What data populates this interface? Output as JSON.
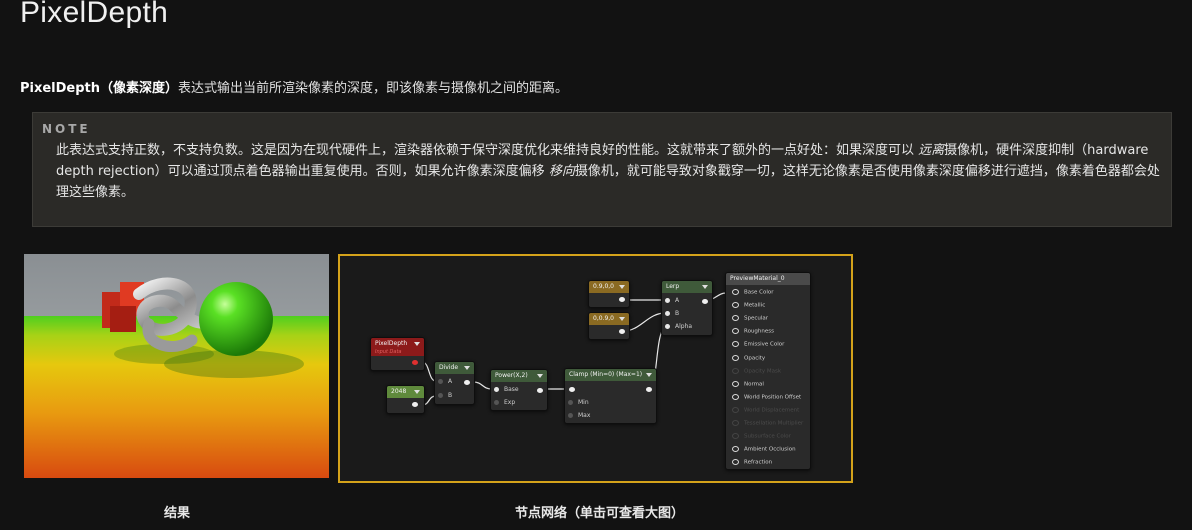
{
  "page": {
    "title": "PixelDepth",
    "intro_bold": "PixelDepth（像素深度）",
    "intro_rest": "表达式输出当前所渲染像素的深度，即该像素与摄像机之间的距离。"
  },
  "note": {
    "label": "NOTE",
    "text_1": "此表达式支持正数，不支持负数。这是因为在现代硬件上，渲染器依赖于保守深度优化来维持良好的性能。这就带来了额外的一点好处：如果深度可以 ",
    "em_1": "远离",
    "text_2": "摄像机，硬件深度抑制（hardware depth rejection）可以通过顶点着色器输出重复使用。否则，如果允许像素深度偏移 ",
    "em_2": "移向",
    "text_3": "摄像机，就可能导致对象戳穿一切，这样无论像素是否使用像素深度偏移进行遮挡，像素着色器都会处理这些像素。"
  },
  "captions": {
    "result": "结果",
    "graph": "节点网络（单击可查看大图）"
  },
  "graph": {
    "pixel_depth": {
      "title": "PixelDepth",
      "subtitle": "Input Data"
    },
    "constant_2048": {
      "value": "2048"
    },
    "divide": {
      "title": "Divide",
      "pin_a": "A",
      "pin_b": "B"
    },
    "power": {
      "title": "Power(X,2)",
      "pin_base": "Base",
      "pin_exp": "Exp"
    },
    "clamp": {
      "title": "Clamp (Min=0) (Max=1)",
      "pin_min": "Min",
      "pin_max": "Max"
    },
    "color_1": {
      "value": "0.9,0,0"
    },
    "color_2": {
      "value": "0,0.9,0"
    },
    "lerp": {
      "title": "Lerp",
      "pin_a": "A",
      "pin_b": "B",
      "pin_alpha": "Alpha"
    },
    "preview": {
      "title": "PreviewMaterial_0",
      "pins": [
        {
          "label": "Base Color",
          "enabled": true
        },
        {
          "label": "Metallic",
          "enabled": true
        },
        {
          "label": "Specular",
          "enabled": true
        },
        {
          "label": "Roughness",
          "enabled": true
        },
        {
          "label": "Emissive Color",
          "enabled": true
        },
        {
          "label": "Opacity",
          "enabled": true
        },
        {
          "label": "Opacity Mask",
          "enabled": false
        },
        {
          "label": "Normal",
          "enabled": true
        },
        {
          "label": "World Position Offset",
          "enabled": true
        },
        {
          "label": "World Displacement",
          "enabled": false
        },
        {
          "label": "Tessellation Multiplier",
          "enabled": false
        },
        {
          "label": "Subsurface Color",
          "enabled": false
        },
        {
          "label": "Ambient Occlusion",
          "enabled": true
        },
        {
          "label": "Refraction",
          "enabled": true
        }
      ]
    }
  },
  "colors": {
    "graph_border": "#d4a21a",
    "pixel_depth_header": "#8c1a1a",
    "constant_header": "#5f8a3c",
    "math_header": "#3f5a3a",
    "vector_header": "#8a6a22"
  }
}
